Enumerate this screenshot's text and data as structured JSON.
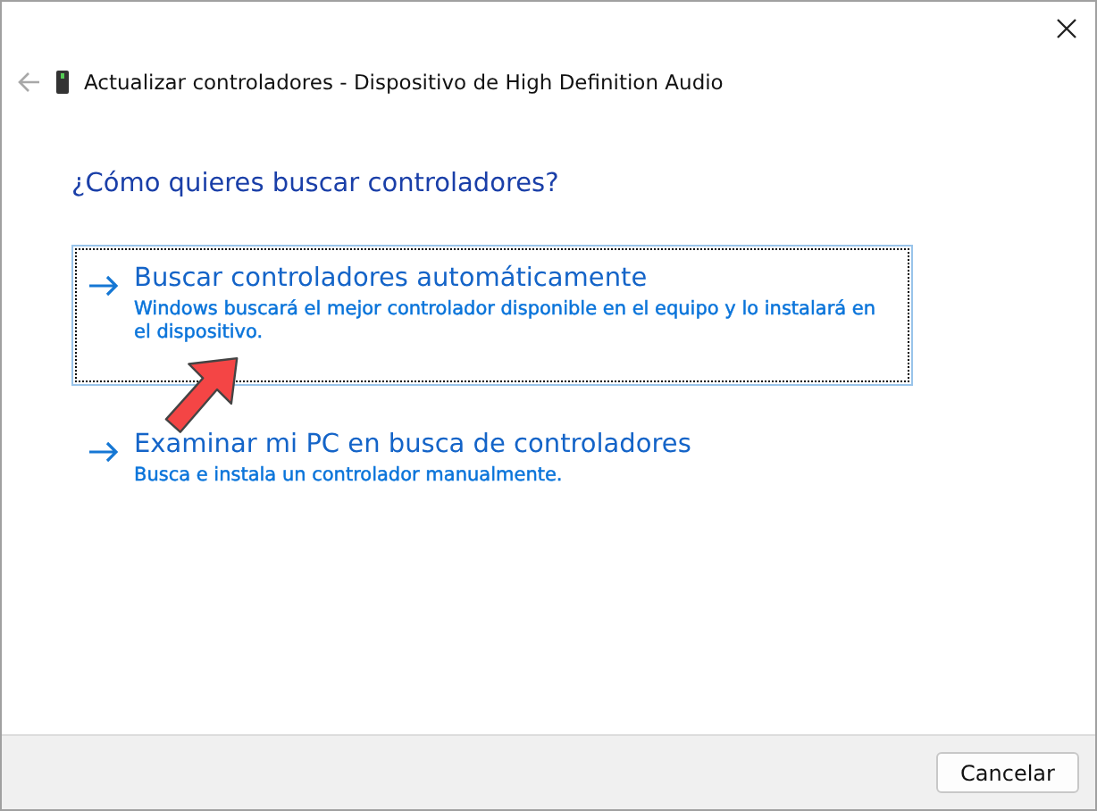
{
  "header": {
    "title": "Actualizar controladores - Dispositivo de High Definition Audio"
  },
  "heading": "¿Cómo quieres buscar controladores?",
  "options": [
    {
      "title": "Buscar controladores automáticamente",
      "description": "Windows buscará el mejor controlador disponible en el equipo y lo instalará en el dispositivo.",
      "selected": true
    },
    {
      "title": "Examinar mi PC en busca de controladores",
      "description": "Busca e instala un controlador manualmente.",
      "selected": false
    }
  ],
  "buttons": [
    {
      "label": "Cancelar"
    }
  ],
  "annotations": [
    {
      "kind": "arrow"
    }
  ]
}
